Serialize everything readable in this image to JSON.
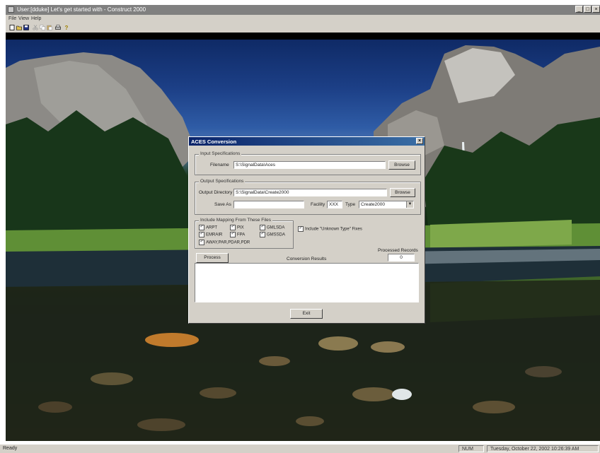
{
  "window": {
    "title": "User:[dduke] Let's get started with - Construct 2000",
    "controls": [
      "_",
      "□",
      "×"
    ]
  },
  "menu": [
    "File",
    "View",
    "Help"
  ],
  "toolbar": {
    "icons": [
      "new-icon",
      "open-icon",
      "save-icon",
      "cut-icon",
      "copy-icon",
      "paste-icon",
      "print-icon",
      "help-icon"
    ]
  },
  "dialog": {
    "title": "ACES Conversion",
    "close": "×",
    "input_group": "Input Specifications",
    "filename_label": "Filename",
    "filename_value": "S:\\SignalData\\Aces",
    "browse1": "Browse",
    "output_group": "Output Specifications",
    "outdir_label": "Output Directory",
    "outdir_value": "S:\\SignalData\\Create2000",
    "browse2": "Browse",
    "saveas_label": "Save As",
    "saveas_value": "",
    "facility_label": "Facility",
    "facility_value": "XXX",
    "type_label": "Type",
    "type_value": "Create2000",
    "mapping_group": "Include Mapping From These Files",
    "checks": [
      "ARPT",
      "PIX",
      "GMLSDA",
      "EMRAIR",
      "FPA",
      "GMSSDA",
      "AWAY,PAR,PDAR,PDR"
    ],
    "unknown_check": "Include \"Unknown Type\" Fixes",
    "processed_label": "Processed Records",
    "processed_value": "0",
    "process_button": "Process",
    "results_label": "Conversion Results",
    "exit_button": "Exit"
  },
  "status": {
    "left": "Ready",
    "num": "NUM",
    "datetime": "Tuesday, October 22, 2002  10:26:39 AM"
  },
  "colors": {
    "titlebar": "#808080",
    "dialog_title": "#0a246a",
    "face": "#d4d0c8"
  }
}
